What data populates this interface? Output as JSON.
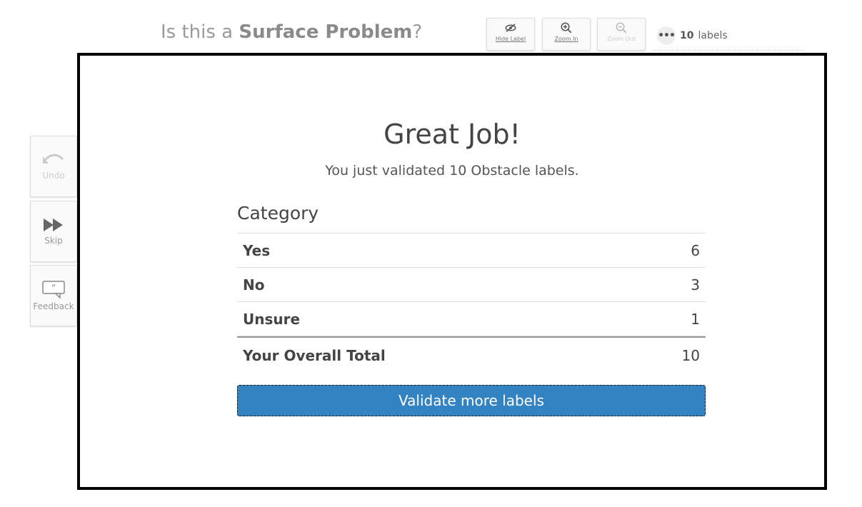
{
  "header": {
    "question_prefix": "Is this a ",
    "question_bold": "Surface Problem",
    "question_suffix": "?"
  },
  "toolbar": {
    "hide_label": "Hide Label",
    "zoom_in": "Zoom In",
    "zoom_out": "Zoom Out",
    "labels_count": "10",
    "labels_word": "labels",
    "dots": "•••"
  },
  "side": {
    "undo": "Undo",
    "skip": "Skip",
    "feedback": "Feedback"
  },
  "modal": {
    "title": "Great Job!",
    "subtitle": "You just validated 10 Obstacle labels.",
    "category_header": "Category",
    "rows": [
      {
        "label": "Yes",
        "value": "6"
      },
      {
        "label": "No",
        "value": "3"
      },
      {
        "label": "Unsure",
        "value": "1"
      }
    ],
    "total_label": "Your Overall Total",
    "total_value": "10",
    "button": "Validate more labels"
  },
  "colors": {
    "accent": "#3383c2",
    "modal_border": "#000000"
  }
}
